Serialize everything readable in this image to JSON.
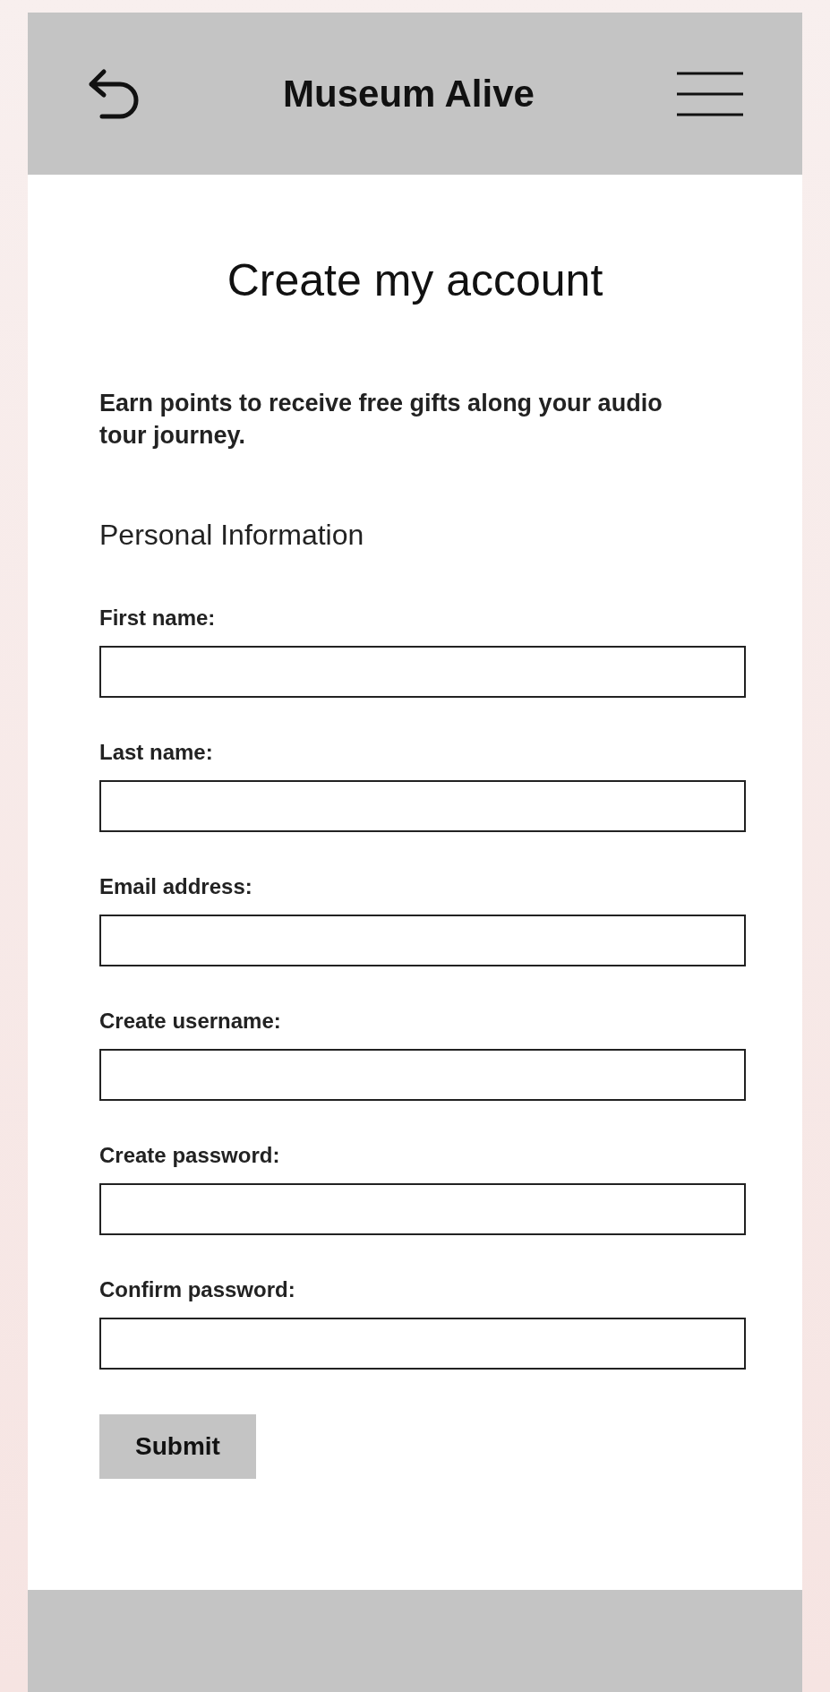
{
  "header": {
    "title": "Museum Alive"
  },
  "page_title": "Create my account",
  "intro": "Earn points to receive free gifts along your audio tour journey.",
  "section_heading": "Personal Information",
  "fields": [
    {
      "label": "First name:"
    },
    {
      "label": "Last name:"
    },
    {
      "label": "Email address:"
    },
    {
      "label": "Create username:"
    },
    {
      "label": "Create password:"
    },
    {
      "label": "Confirm password:"
    }
  ],
  "submit_button": "Submit"
}
